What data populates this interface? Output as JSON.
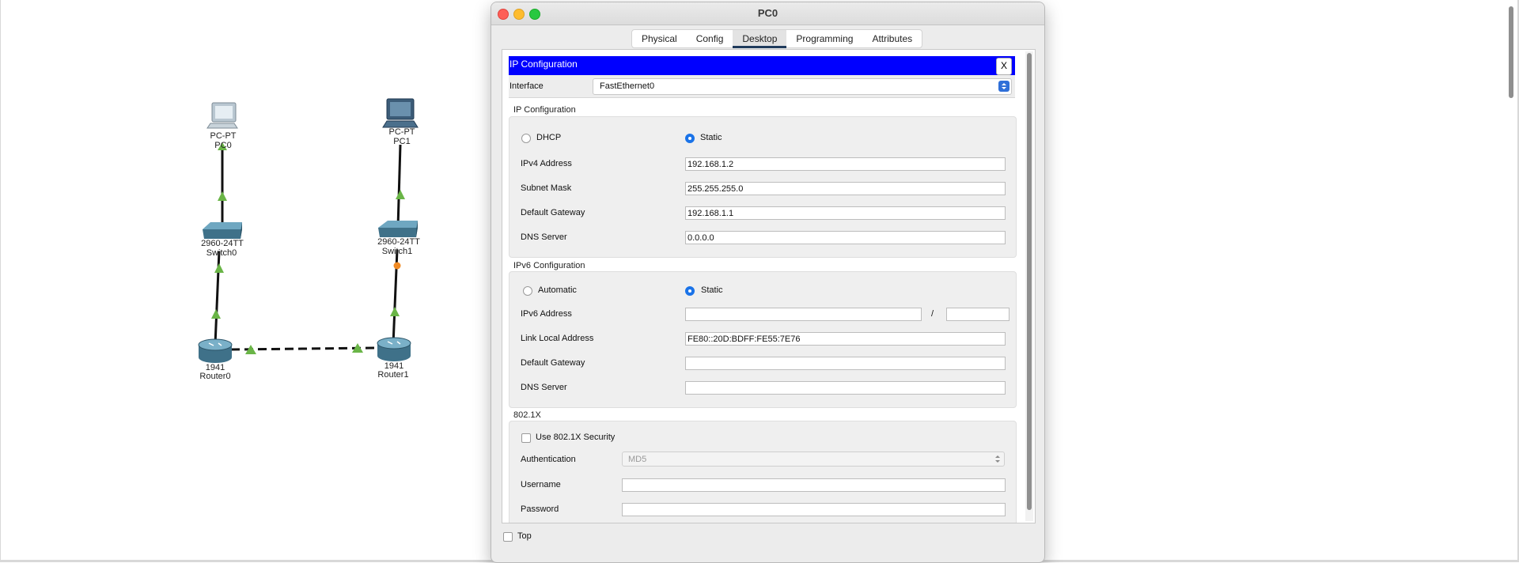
{
  "window": {
    "title": "PC0"
  },
  "tabs": [
    {
      "label": "Physical",
      "active": false
    },
    {
      "label": "Config",
      "active": false
    },
    {
      "label": "Desktop",
      "active": true
    },
    {
      "label": "Programming",
      "active": false
    },
    {
      "label": "Attributes",
      "active": false
    }
  ],
  "ip_config_panel": {
    "header_title": "IP Configuration",
    "close_label": "X",
    "interface_label": "Interface",
    "interface_value": "FastEthernet0",
    "ipv4": {
      "section_title": "IP Configuration",
      "dhcp_label": "DHCP",
      "static_label": "Static",
      "selected_mode": "Static",
      "fields": {
        "ipv4_address": {
          "label": "IPv4 Address",
          "value": "192.168.1.2"
        },
        "subnet_mask": {
          "label": "Subnet Mask",
          "value": "255.255.255.0"
        },
        "default_gateway": {
          "label": "Default Gateway",
          "value": "192.168.1.1"
        },
        "dns_server": {
          "label": "DNS Server",
          "value": "0.0.0.0"
        }
      }
    },
    "ipv6": {
      "section_title": "IPv6 Configuration",
      "automatic_label": "Automatic",
      "static_label": "Static",
      "selected_mode": "Static",
      "fields": {
        "ipv6_address": {
          "label": "IPv6 Address",
          "value": "",
          "separator": "/",
          "prefix": ""
        },
        "link_local": {
          "label": "Link Local Address",
          "value": "FE80::20D:BDFF:FE55:7E76"
        },
        "default_gateway": {
          "label": "Default Gateway",
          "value": ""
        },
        "dns_server": {
          "label": "DNS Server",
          "value": ""
        }
      }
    },
    "dot1x": {
      "section_title": "802.1X",
      "use_security_label": "Use 802.1X Security",
      "use_security_checked": false,
      "authentication_label": "Authentication",
      "authentication_value": "MD5",
      "username_label": "Username",
      "username_value": "",
      "password_label": "Password",
      "password_value": ""
    }
  },
  "footer": {
    "top_label": "Top",
    "top_checked": false
  },
  "topology": {
    "devices": [
      {
        "type": "pc",
        "model": "PC-PT",
        "name": "PC0"
      },
      {
        "type": "pc",
        "model": "PC-PT",
        "name": "PC1"
      },
      {
        "type": "switch",
        "model": "2960-24TT",
        "name": "Switch0"
      },
      {
        "type": "switch",
        "model": "2960-24TT",
        "name": "Switch1"
      },
      {
        "type": "router",
        "model": "1941",
        "name": "Router0"
      },
      {
        "type": "router",
        "model": "1941",
        "name": "Router1"
      }
    ],
    "link_status_colors": {
      "up": "#6ab547",
      "blocking": "#f08a24"
    }
  },
  "colors": {
    "header_blue": "#0000ff",
    "radio_selected": "#1a73e8",
    "tab_underline": "#1f3b5c"
  }
}
